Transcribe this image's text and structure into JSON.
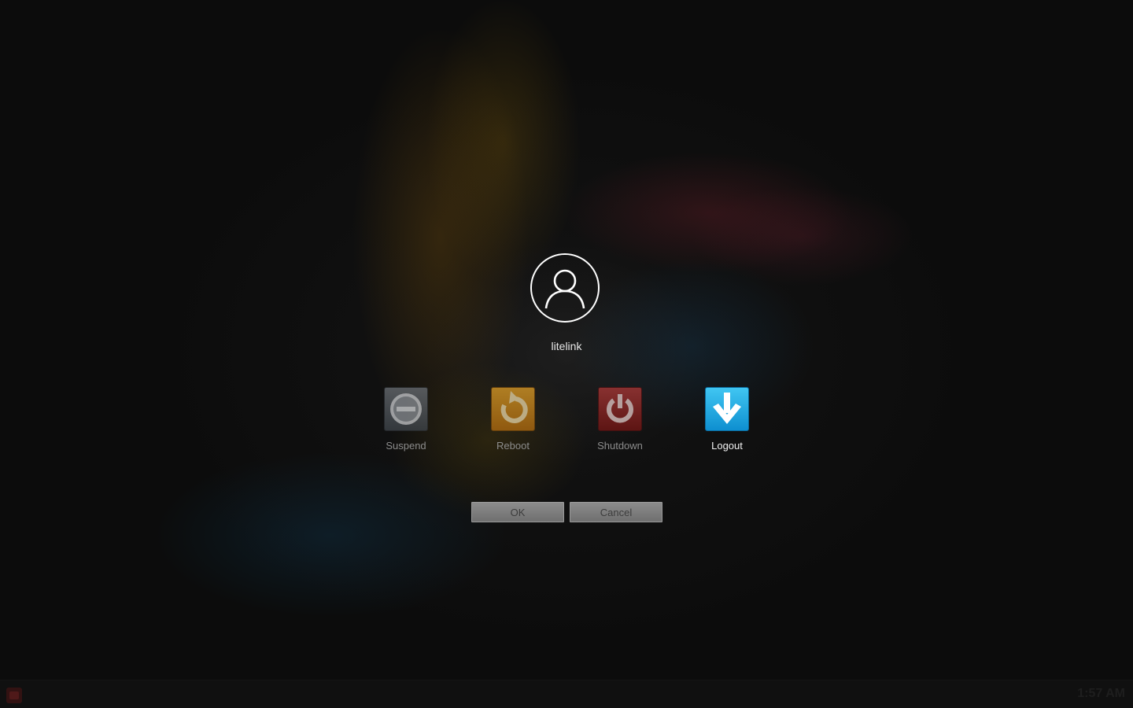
{
  "user": {
    "name": "litelink",
    "avatar_icon": "user-silhouette-icon"
  },
  "actions": [
    {
      "id": "suspend",
      "label": "Suspend",
      "icon": "suspend-icon",
      "color": "#5a6066",
      "selected": false
    },
    {
      "id": "reboot",
      "label": "Reboot",
      "icon": "reboot-icon",
      "color": "#d08a1c",
      "selected": false
    },
    {
      "id": "shutdown",
      "label": "Shutdown",
      "icon": "power-icon",
      "color": "#9a2624",
      "selected": false
    },
    {
      "id": "logout",
      "label": "Logout",
      "icon": "logout-arrow-icon",
      "color": "#22a8e4",
      "selected": true
    }
  ],
  "buttons": {
    "ok_label": "OK",
    "cancel_label": "Cancel"
  },
  "taskbar": {
    "menu_icon": "app-menu-icon",
    "clock": "1:57 AM"
  }
}
